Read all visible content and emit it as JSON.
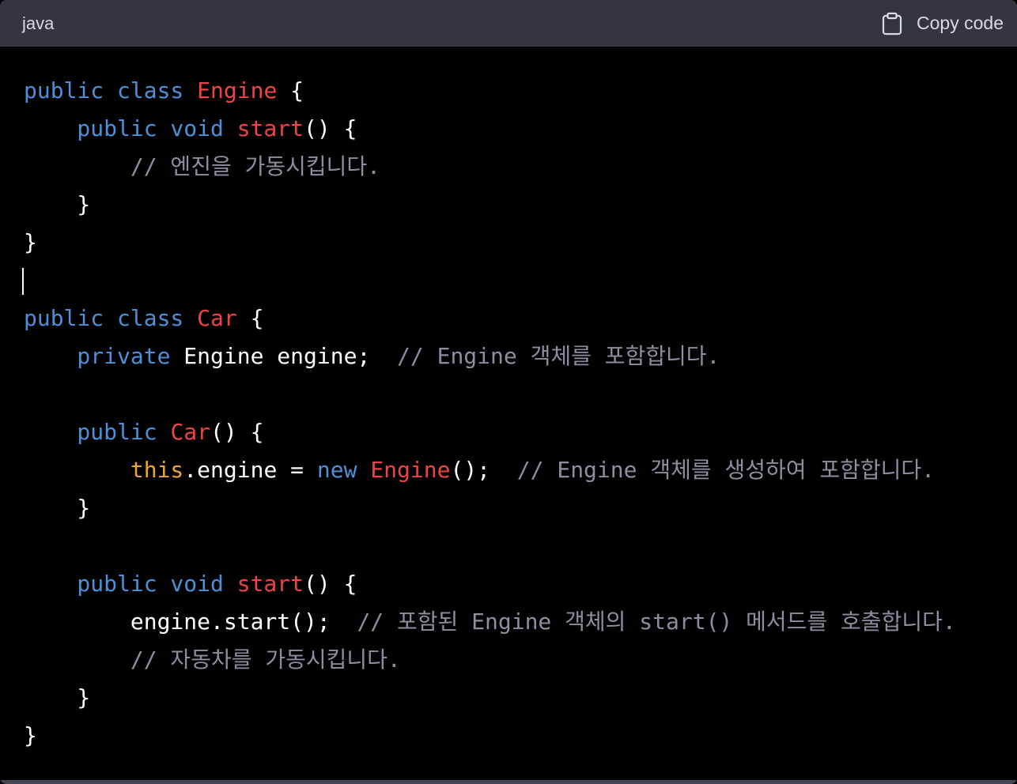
{
  "header": {
    "language": "java",
    "copy_label": "Copy code"
  },
  "code": {
    "l1": {
      "a": "public class ",
      "b": "Engine",
      "c": " {"
    },
    "l2": {
      "a": "    public void ",
      "b": "start",
      "c": "() {"
    },
    "l3": {
      "a": "        // 엔진을 가동시킵니다."
    },
    "l4": {
      "a": "    }"
    },
    "l5": {
      "a": "}"
    },
    "l7": {
      "a": "public class ",
      "b": "Car",
      "c": " {"
    },
    "l8": {
      "a": "    private ",
      "b": "Engine engine;  ",
      "c": "// Engine 객체를 포함합니다."
    },
    "l10": {
      "a": "    public ",
      "b": "Car",
      "c": "() {"
    },
    "l11": {
      "a": "        ",
      "b": "this",
      "c": ".engine = ",
      "d": "new ",
      "e": "Engine",
      "f": "();  ",
      "g": "// Engine 객체를 생성하여 포함합니다."
    },
    "l12": {
      "a": "    }"
    },
    "l14": {
      "a": "    public void ",
      "b": "start",
      "c": "() {"
    },
    "l15": {
      "a": "        engine.start();  ",
      "b": "// 포함된 Engine 객체의 start() 메서드를 호출합니다."
    },
    "l16": {
      "a": "        // 자동차를 가동시킵니다."
    },
    "l17": {
      "a": "    }"
    },
    "l18": {
      "a": "}"
    }
  },
  "colors": {
    "keyword": "#4d8fd8",
    "identifier": "#ef4444",
    "comment": "#8e8ea0",
    "this_keyword": "#f0a432",
    "header_bg": "#343541"
  }
}
